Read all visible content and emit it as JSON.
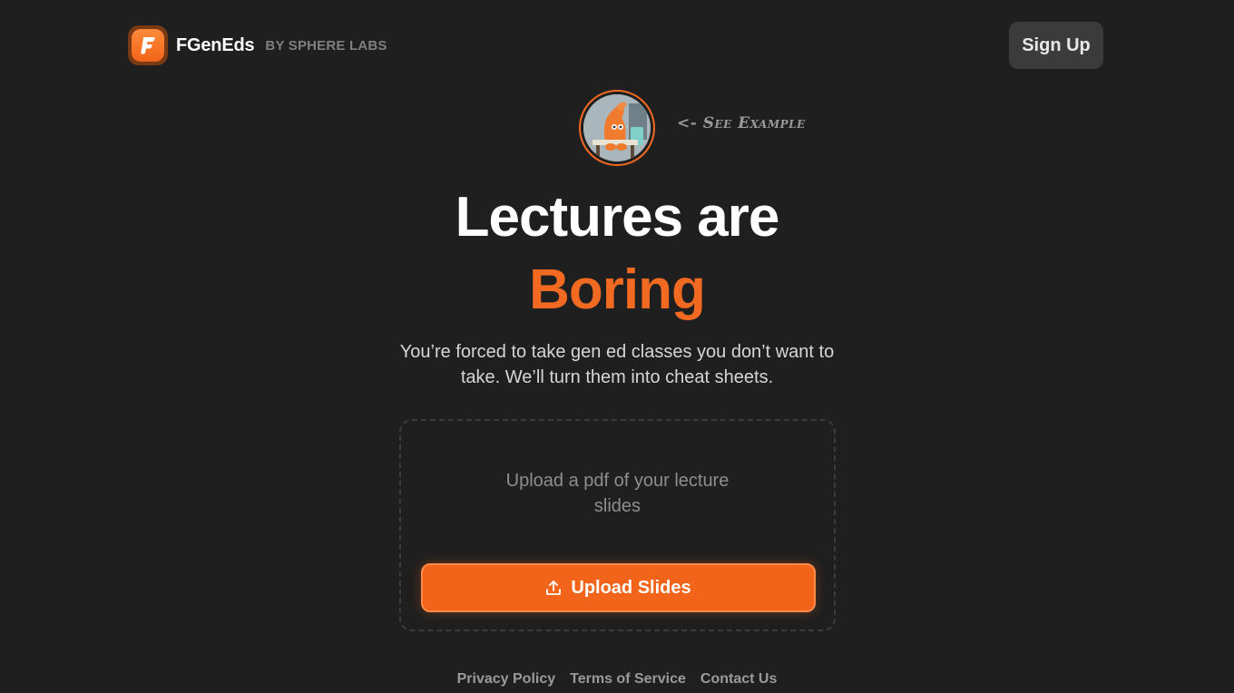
{
  "header": {
    "brand_name": "FGenEds",
    "brand_byline": "BY SPHERE LABS",
    "signup_label": "Sign Up"
  },
  "example": {
    "label": "<- See Example"
  },
  "hero": {
    "line1": "Lectures are",
    "line2": "Boring",
    "subtitle": "You’re forced to take gen ed classes you don’t want to take. We’ll turn them into cheat sheets."
  },
  "upload": {
    "hint": "Upload a pdf of your lecture slides",
    "button_label": "Upload Slides"
  },
  "footer": {
    "links": [
      "Privacy Policy",
      "Terms of Service",
      "Contact Us"
    ]
  },
  "colors": {
    "background": "#1f1f1f",
    "accent": "#f26a21",
    "signup_bg": "#3b3b3b"
  }
}
